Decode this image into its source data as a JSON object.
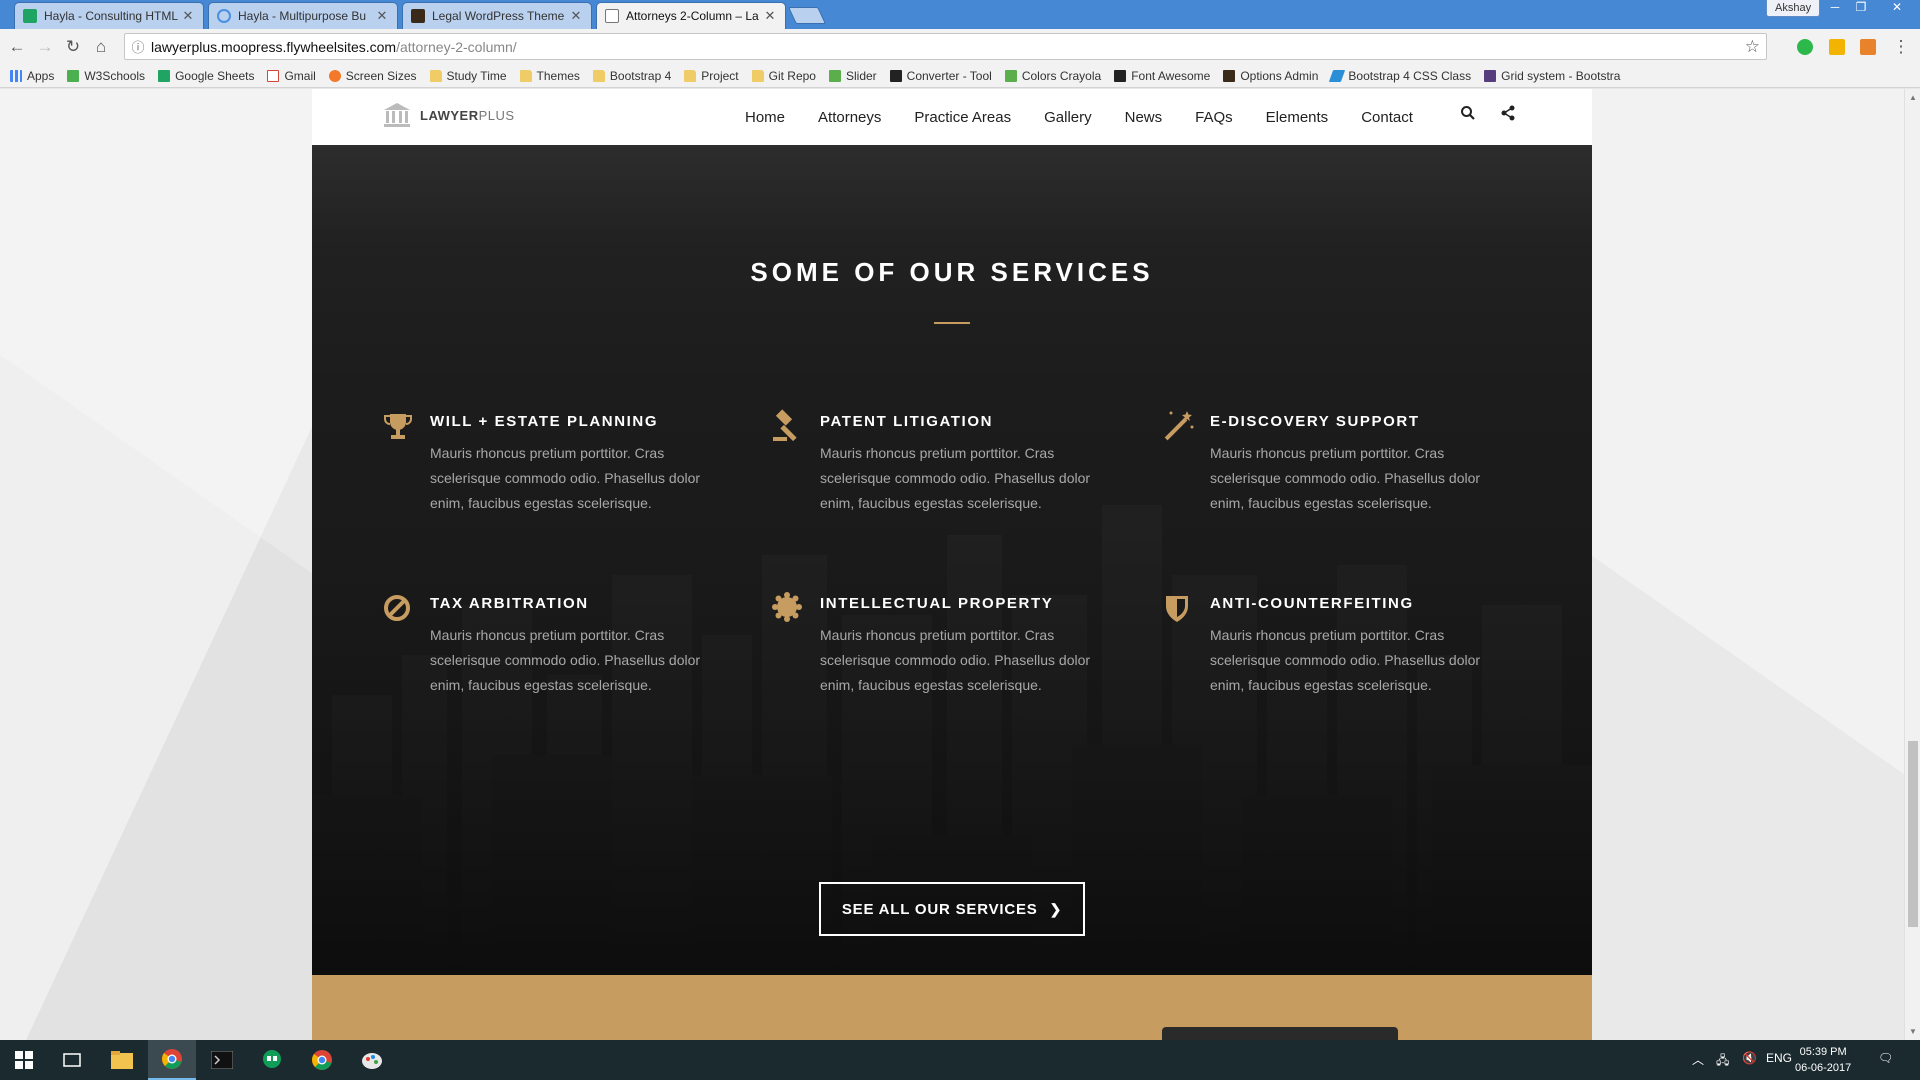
{
  "browser": {
    "tabs": [
      {
        "title": "Hayla - Consulting HTML",
        "icon": "sheets-icon",
        "active": false
      },
      {
        "title": "Hayla - Multipurpose Bu",
        "icon": "globe-icon",
        "active": false
      },
      {
        "title": "Legal WordPress Theme",
        "icon": "theme-icon",
        "active": false
      },
      {
        "title": "Attorneys 2-Column – La",
        "icon": "page-icon",
        "active": true
      }
    ],
    "tab_close": "✕",
    "profile_name": "Akshay",
    "url_host": "lawyerplus.moopress.flywheelsites.com",
    "url_path": "/attorney-2-column/",
    "bookmarks": [
      {
        "label": "Apps",
        "icon": "apps-icon"
      },
      {
        "label": "W3Schools",
        "icon": "w3-icon"
      },
      {
        "label": "Google Sheets",
        "icon": "sheets-icon"
      },
      {
        "label": "Gmail",
        "icon": "gmail-icon"
      },
      {
        "label": "Screen Sizes",
        "icon": "gear-icon"
      },
      {
        "label": "Study Time",
        "icon": "folder-icon"
      },
      {
        "label": "Themes",
        "icon": "folder-icon"
      },
      {
        "label": "Bootstrap 4",
        "icon": "folder-icon"
      },
      {
        "label": "Project",
        "icon": "folder-icon"
      },
      {
        "label": "Git Repo",
        "icon": "folder-icon"
      },
      {
        "label": "Slider",
        "icon": "image-icon"
      },
      {
        "label": "Converter - Tool",
        "icon": "bt-icon"
      },
      {
        "label": "Colors Crayola",
        "icon": "image-icon"
      },
      {
        "label": "Font Awesome",
        "icon": "flag-icon"
      },
      {
        "label": "Options Admin",
        "icon": "theme-icon"
      },
      {
        "label": "Bootstrap 4 CSS Class",
        "icon": "feather-icon"
      },
      {
        "label": "Grid system - Bootstra",
        "icon": "bootstrap-icon"
      }
    ]
  },
  "site": {
    "logo_bold": "LAWYER",
    "logo_light": "PLUS",
    "nav": [
      "Home",
      "Attorneys",
      "Practice Areas",
      "Gallery",
      "News",
      "FAQs",
      "Elements",
      "Contact"
    ],
    "services_title": "SOME OF OUR SERVICES",
    "services": [
      {
        "title": "WILL + ESTATE PLANNING",
        "icon": "trophy-icon",
        "text": "Mauris rhoncus pretium porttitor. Cras scelerisque commodo odio. Phasellus dolor enim, faucibus egestas scelerisque."
      },
      {
        "title": "PATENT LITIGATION",
        "icon": "gavel-icon",
        "text": "Mauris rhoncus pretium porttitor. Cras scelerisque commodo odio. Phasellus dolor enim, faucibus egestas scelerisque."
      },
      {
        "title": "E-DISCOVERY SUPPORT",
        "icon": "magic-wand-icon",
        "text": "Mauris rhoncus pretium porttitor. Cras scelerisque commodo odio. Phasellus dolor enim, faucibus egestas scelerisque."
      },
      {
        "title": "TAX ARBITRATION",
        "icon": "ban-icon",
        "text": "Mauris rhoncus pretium porttitor. Cras scelerisque commodo odio. Phasellus dolor enim, faucibus egestas scelerisque."
      },
      {
        "title": "INTELLECTUAL PROPERTY",
        "icon": "certificate-icon",
        "text": "Mauris rhoncus pretium porttitor. Cras scelerisque commodo odio. Phasellus dolor enim, faucibus egestas scelerisque."
      },
      {
        "title": "ANTI-COUNTERFEITING",
        "icon": "shield-icon",
        "text": "Mauris rhoncus pretium porttitor. Cras scelerisque commodo odio. Phasellus dolor enim, faucibus egestas scelerisque."
      }
    ],
    "cta_label": "SEE ALL OUR SERVICES"
  },
  "taskbar": {
    "language": "ENG",
    "time": "05:39 PM",
    "date": "06-06-2017"
  },
  "colors": {
    "accent_gold": "#c79c60",
    "chrome_blue": "#4688d3",
    "dark_bg": "#1a1a1a"
  }
}
